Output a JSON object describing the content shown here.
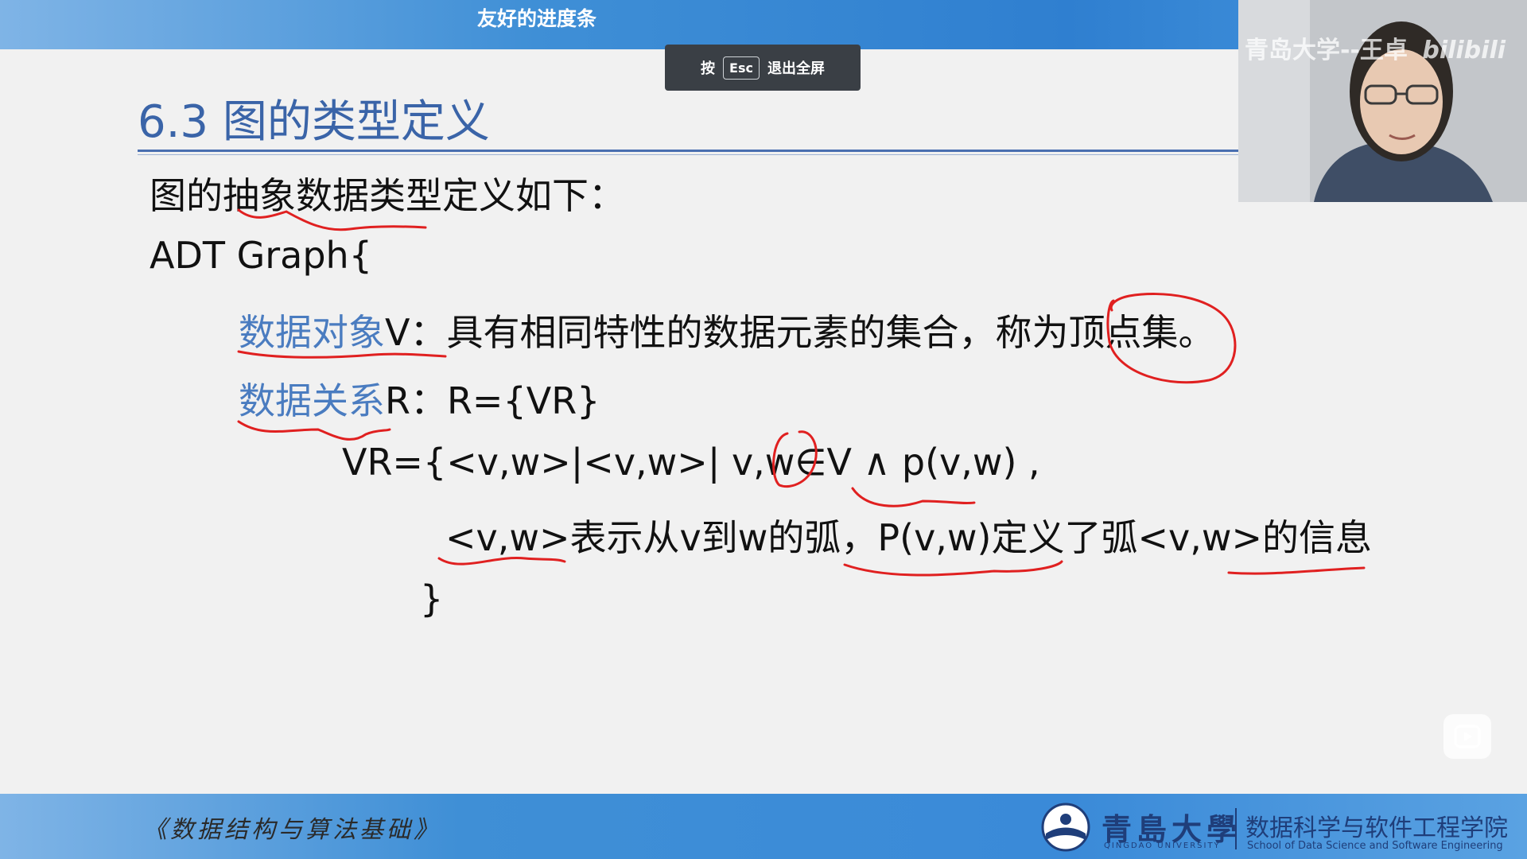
{
  "header": {
    "title": "友好的进度条"
  },
  "fullscreen_toast": {
    "prefix": "按",
    "key": "Esc",
    "suffix": "退出全屏"
  },
  "slide": {
    "title": "6.3 图的类型定义",
    "lines": {
      "intro": "图的抽象数据类型定义如下：",
      "adt_open": "ADT Graph{",
      "data_object_label": "数据对象",
      "data_object_rest": "V：具有相同特性的数据元素的集合，称为顶点集。",
      "data_relation_label": "数据关系",
      "data_relation_rest": "R：R={VR}",
      "vr_def": "VR={<v,w>|<v,w>| v,w∈V ∧ p(v,w) ,",
      "arc_desc": "<v,w>表示从v到w的弧，P(v,w)定义了弧<v,w>的信息",
      "close_brace": "}"
    }
  },
  "webcam": {
    "watermark": "青岛大学--王卓",
    "brand": "bilibili"
  },
  "footer": {
    "course": "《数据结构与算法基础》",
    "university_cn": "青島大學",
    "university_en": "QINGDAO UNIVERSITY",
    "school_cn": "数据科学与软件工程学院",
    "school_en": "School of Data Science and Software Engineering"
  },
  "colors": {
    "accent_blue": "#4a7cc0",
    "ink_red": "#e02020",
    "bar_blue": "#3f8fd6"
  }
}
